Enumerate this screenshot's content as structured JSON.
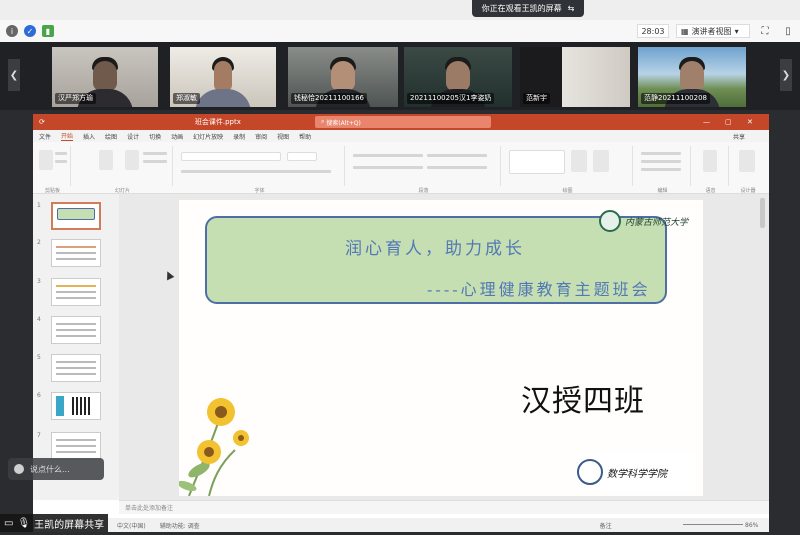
{
  "meeting": {
    "sharing_banner": "你正在观看王凯的屏幕",
    "timer": "28:03",
    "view_mode": "演讲者视图",
    "sharer_label": "王凯的屏幕共享",
    "chat_placeholder": "说点什么..."
  },
  "participants": [
    {
      "name": "汉严郑方瑜"
    },
    {
      "name": "郑淑敏"
    },
    {
      "name": "钱秘恰20211100166"
    },
    {
      "name": "20211100205汉1李姿奶"
    },
    {
      "name": "范新宇"
    },
    {
      "name": "范静20211100208"
    }
  ],
  "ppt": {
    "file_name": "班会课件.pptx",
    "search_placeholder": "搜索(Alt+Q)",
    "menu": [
      "文件",
      "开始",
      "插入",
      "绘图",
      "设计",
      "切换",
      "动画",
      "幻灯片放映",
      "录制",
      "审阅",
      "视图",
      "帮助"
    ],
    "active_menu": "开始",
    "share_label": "共享",
    "ribbon_groups": [
      "剪贴板",
      "幻灯片",
      "字体",
      "段落",
      "绘图",
      "编辑",
      "语音",
      "设计器"
    ],
    "notes_placeholder": "单击此处添加备注",
    "status_left": "中文(中国)",
    "status_accessibility": "辅助功能: 调查",
    "status_notes": "备注",
    "zoom": "86%",
    "thumbnail_numbers": [
      "1",
      "2",
      "3",
      "4",
      "5",
      "6",
      "7"
    ]
  },
  "slide": {
    "slogan_1": "润心育人，助力成长",
    "slogan_2": "----心理健康教育主题班会",
    "class_name": "汉授四班",
    "university_name": "内蒙古师范大学",
    "school_name": "数学科学学院"
  },
  "colors": {
    "ppt_accent": "#c5472a",
    "banner_fill": "#c5dfb3",
    "banner_border": "#4d6fa5",
    "slogan_text": "#5378b5"
  }
}
